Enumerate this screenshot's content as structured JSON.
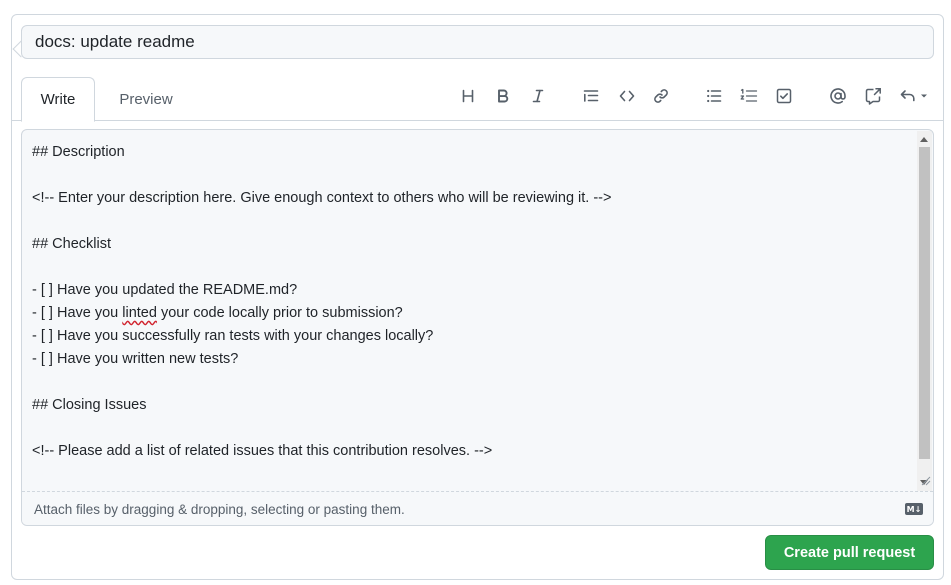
{
  "title_field": {
    "value": "docs: update readme"
  },
  "tabs": [
    {
      "label": "Write",
      "active": true
    },
    {
      "label": "Preview",
      "active": false
    }
  ],
  "toolbar": {
    "icons": [
      "heading-icon",
      "bold-icon",
      "italic-icon",
      "quote-icon",
      "code-icon",
      "link-icon",
      "unordered-list-icon",
      "ordered-list-icon",
      "task-list-icon",
      "mention-icon",
      "cross-reference-icon",
      "reply-icon"
    ],
    "icon_color": "#57606a"
  },
  "body": {
    "lines": [
      "## Description",
      "",
      "<!-- Enter your description here. Give enough context to others who will be reviewing it. -->",
      "",
      "## Checklist",
      "",
      "- [ ] Have you updated the README.md?",
      "- [ ] Have you ",
      "- [ ] Have you successfully ran tests with your changes locally?",
      "- [ ] Have you written new tests?",
      "",
      "## Closing Issues",
      "",
      "<!-- Please add a list of related issues that this contribution resolves. -->"
    ],
    "misspelled_word": "linted",
    "line8_rest": " your code locally prior to submission?"
  },
  "footer": {
    "attach_text": "Attach files by dragging & dropping, selecting or pasting them.",
    "markdown_badge": "M↓"
  },
  "actions": {
    "create_label": "Create pull request"
  },
  "colors": {
    "primary_button": "#2da44e",
    "border": "#d0d7de",
    "muted_text": "#57606a",
    "field_bg": "#f6f8fa"
  }
}
